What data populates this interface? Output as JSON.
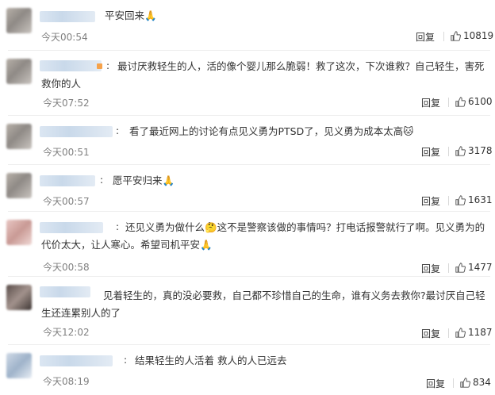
{
  "comments": [
    {
      "text": "平安回来",
      "emoji": "🙏",
      "time": "今天00:54",
      "reply": "回复",
      "likes": "10819"
    },
    {
      "text": "最讨厌救轻生的人，活的像个婴儿那么脆弱！救了这次，下次谁救？自己轻生，害死救你的人",
      "time": "今天07:52",
      "reply": "回复",
      "likes": "6100"
    },
    {
      "text": "看了最近网上的讨论有点见义勇为PTSD了，见义勇为成本太高",
      "emoji": "🐱",
      "time": "今天00:51",
      "reply": "回复",
      "likes": "3178"
    },
    {
      "text": "愿平安归来",
      "emoji": "🙏",
      "time": "今天00:57",
      "reply": "回复",
      "likes": "1631"
    },
    {
      "text_a": "还见义勇为做什么",
      "emoji_mid": "🤔",
      "text_b": "这不是警察该做的事情吗？打电话报警就行了啊。见义勇为的代价太大，让人寒心。希望司机平安",
      "emoji": "🙏",
      "time": "今天00:58",
      "reply": "回复",
      "likes": "1477"
    },
    {
      "text": "见着轻生的，真的没必要救，自己都不珍惜自己的生命，谁有义务去救你?最讨厌自己轻生还连累别人的了",
      "time": "今天12:02",
      "reply": "回复",
      "likes": "1187"
    },
    {
      "text": "结果轻生的人活着 救人的人已远去",
      "time": "今天08:19",
      "reply": "回复",
      "likes": "834"
    }
  ],
  "icons": {
    "like": "thumbs-up-icon",
    "accent": "#f6a24a"
  }
}
